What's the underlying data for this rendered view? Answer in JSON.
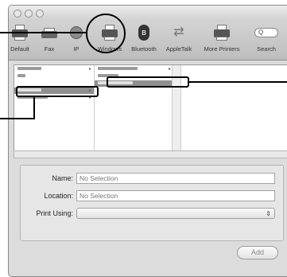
{
  "toolbar": {
    "items": [
      {
        "label": "Default",
        "icon": "printer-icon"
      },
      {
        "label": "Fax",
        "icon": "fax-icon"
      },
      {
        "label": "IP",
        "icon": "globe-icon"
      },
      {
        "label": "Windows",
        "icon": "printer-icon"
      },
      {
        "label": "Bluetooth",
        "icon": "bluetooth-icon"
      },
      {
        "label": "AppleTalk",
        "icon": "arrows-icon"
      },
      {
        "label": "More Printers",
        "icon": "printer-icon"
      },
      {
        "label": "Search",
        "icon": "search-icon"
      }
    ],
    "search_placeholder": "Q"
  },
  "form": {
    "name_label": "Name:",
    "name_value": "No Selection",
    "location_label": "Location:",
    "location_value": "No Selection",
    "print_using_label": "Print Using:",
    "print_using_value": ""
  },
  "add_button": "Add",
  "colors": {
    "window_bg": "#dcdcdc",
    "toolbar_bg": "#c8c8c8",
    "selection": "#8f8f8f",
    "callout": "#000000"
  }
}
